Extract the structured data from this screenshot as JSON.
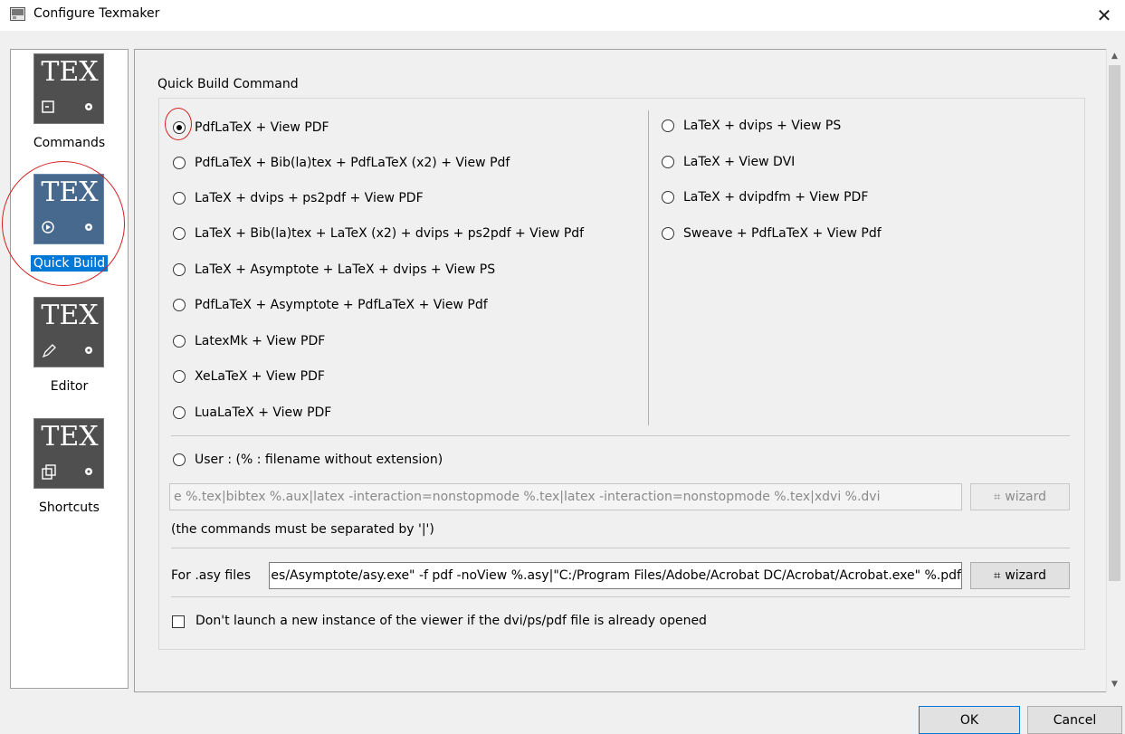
{
  "window": {
    "title": "Configure Texmaker",
    "close_glyph": "✕"
  },
  "sidebar": {
    "tile_text": "TEX",
    "items": [
      {
        "label": "Commands",
        "icon": "terminal-settings-icon"
      },
      {
        "label": "Quick Build",
        "icon": "play-settings-icon",
        "selected": true
      },
      {
        "label": "Editor",
        "icon": "pencil-settings-icon"
      },
      {
        "label": "Shortcuts",
        "icon": "shortcut-settings-icon"
      }
    ]
  },
  "quick_build": {
    "title": "Quick Build Command",
    "left_options": [
      "PdfLaTeX + View PDF",
      "PdfLaTeX + Bib(la)tex + PdfLaTeX (x2) + View Pdf",
      "LaTeX + dvips + ps2pdf + View PDF",
      "LaTeX + Bib(la)tex + LaTeX (x2) + dvips + ps2pdf + View Pdf",
      "LaTeX + Asymptote + LaTeX + dvips + View PS",
      "PdfLaTeX + Asymptote + PdfLaTeX + View Pdf",
      "LatexMk + View PDF",
      "XeLaTeX + View PDF",
      "LuaLaTeX + View PDF"
    ],
    "right_options": [
      "LaTeX + dvips + View PS",
      "LaTeX + View DVI",
      "LaTeX + dvipdfm + View PDF",
      "Sweave + PdfLaTeX + View Pdf"
    ],
    "selected": "PdfLaTeX + View PDF",
    "user_option": "User : (% : filename without extension)",
    "user_command": "e %.tex|bibtex %.aux|latex -interaction=nonstopmode %.tex|latex -interaction=nonstopmode %.tex|xdvi %.dvi",
    "separator_note": "(the commands must be separated by '|')",
    "asy_label": "For .asy files",
    "asy_command": "\"C:/Program Files/Asymptote/asy.exe\" -f pdf -noView %.asy|\"C:/Program Files/Adobe/Acrobat DC/Acrobat/Acrobat.exe\" %.pdf",
    "wizard_label": "wizard",
    "viewer_checkbox": "Don't launch a new instance of the viewer if the dvi/ps/pdf file is already opened",
    "viewer_checked": false
  },
  "buttons": {
    "ok": "OK",
    "cancel": "Cancel"
  },
  "colors": {
    "selection": "#0078d7",
    "annotation": "#d42020",
    "tile": "#4f4f4f",
    "tile_selected": "#47698d"
  }
}
